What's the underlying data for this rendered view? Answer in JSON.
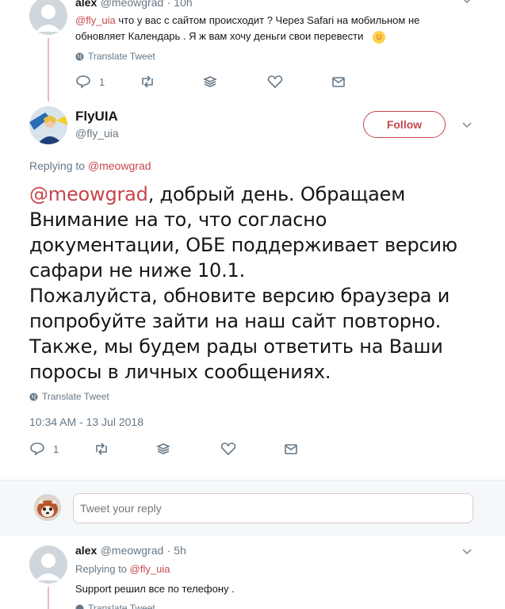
{
  "tweet1": {
    "name": "alex",
    "handle": "@meowgrad",
    "time": "· 10h",
    "mention": "@fly_uia",
    "text_line1": " что у вас с сайтом происходит ? Через Safari на мобильном не",
    "text_line2": "обновляет Календарь . Я ж вам хочу деньги свои перевести",
    "emoji": "☺",
    "translate": "Translate Tweet",
    "reply_count": "1"
  },
  "main_tweet": {
    "name": "FlyUIA",
    "handle": "@fly_uia",
    "follow_label": "Follow",
    "replying_prefix": "Replying to",
    "replying_to": "@meowgrad",
    "mention": "@meowgrad",
    "text_line1_rest": ", добрый день. Обращаем",
    "text_lines": [
      "Внимание на то, что согласно",
      "документации, ОБЕ поддерживает версию",
      "сафари не ниже 10.1.",
      "Пожалуйста, обновите версию браузера и",
      "попробуйте зайти на наш сайт повторно.",
      "Также, мы будем рады ответить на Ваши",
      "поросы в личных сообщениях."
    ],
    "translate": "Translate Tweet",
    "timestamp": "10:34 AM - 13 Jul 2018",
    "reply_count": "1"
  },
  "reply_box": {
    "placeholder": "Tweet your reply"
  },
  "tweet3": {
    "name": "alex",
    "handle": "@meowgrad",
    "time": "· 5h",
    "replying_prefix": "Replying to",
    "replying_to": "@fly_uia",
    "text": "Support решил все по телефону .",
    "translate": "Translate Tweet"
  },
  "colors": {
    "accent": "#c8464b",
    "gray": "#657786"
  }
}
